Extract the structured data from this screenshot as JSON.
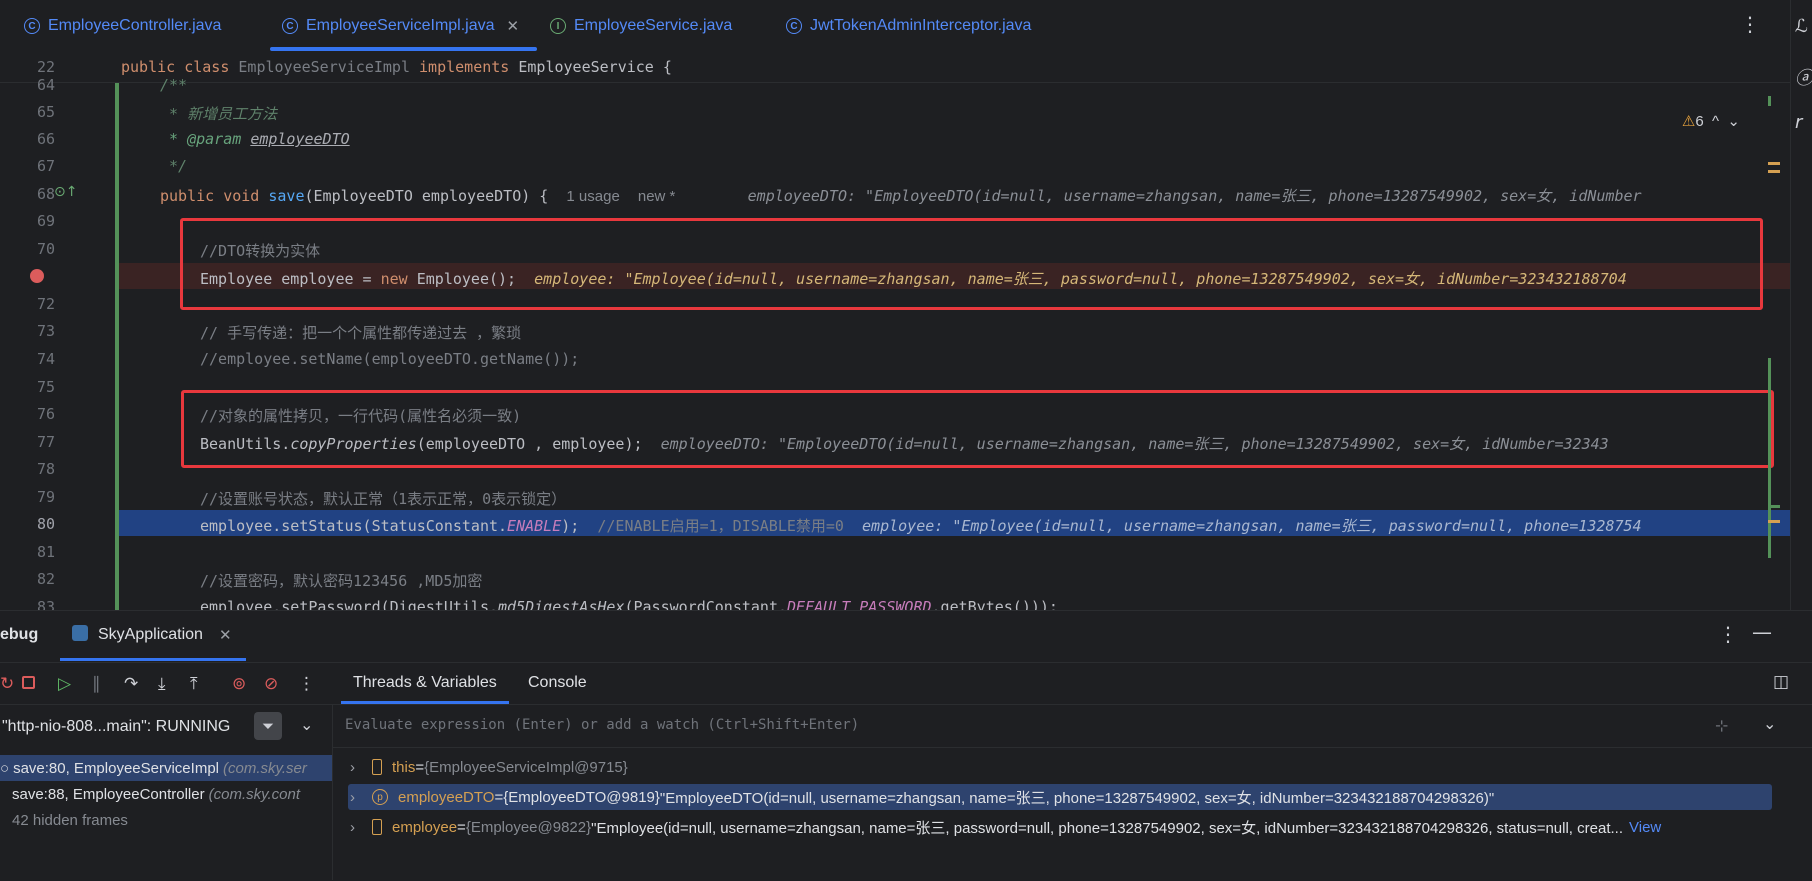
{
  "tabs": [
    {
      "label": "EmployeeController.java",
      "icon": "class-icon"
    },
    {
      "label": "EmployeeServiceImpl.java",
      "icon": "class-icon",
      "active": true
    },
    {
      "label": "EmployeeService.java",
      "icon": "interface-icon"
    },
    {
      "label": "JwtTokenAdminInterceptor.java",
      "icon": "class-icon"
    }
  ],
  "right_strip": [
    "ℒ",
    "ⓐ",
    "r"
  ],
  "editor": {
    "sticky": {
      "line": "22",
      "kw1": "public class ",
      "cls": "EmployeeServiceImpl ",
      "kw2": "implements ",
      "iface": "EmployeeService {"
    },
    "inspections": "6",
    "lines": {
      "64": {
        "num": "64",
        "text": "/**"
      },
      "65": {
        "num": "65",
        "text": " * 新增员工方法"
      },
      "66": {
        "num": "66",
        "tag": " * @param ",
        "param": "employeeDTO"
      },
      "67": {
        "num": "67",
        "text": " */"
      },
      "68": {
        "num": "68",
        "kw": "public void ",
        "fn": "save",
        "rest": "(EmployeeDTO employeeDTO) {",
        "usage": "1 usage",
        "new": "new *",
        "hint": "employeeDTO: \"EmployeeDTO(id=null, username=zhangsan, name=张三, phone=13287549902, sex=女, idNumber"
      },
      "69": {
        "num": "69"
      },
      "70": {
        "num": "70",
        "text": "//DTO转换为实体"
      },
      "71": {
        "pre": "Employee employee = ",
        "kw": "new ",
        "post": "Employee();",
        "hint": "employee: \"Employee(id=null, username=zhangsan, name=张三, password=null, phone=13287549902, sex=女, idNumber=323432188704"
      },
      "72": {
        "num": "72"
      },
      "73": {
        "num": "73",
        "text": "// 手写传递：把一个个属性都传递过去 ，繁琐"
      },
      "74": {
        "num": "74",
        "text": "//employee.setName(employeeDTO.getName());"
      },
      "75": {
        "num": "75"
      },
      "76": {
        "num": "76",
        "text": "//对象的属性拷贝，一行代码(属性名必须一致)"
      },
      "77": {
        "num": "77",
        "pre": "BeanUtils.",
        "fn": "copyProperties",
        "post": "(employeeDTO , employee);",
        "hint": "employeeDTO: \"EmployeeDTO(id=null, username=zhangsan, name=张三, phone=13287549902, sex=女, idNumber=32343"
      },
      "78": {
        "num": "78"
      },
      "79": {
        "num": "79",
        "text": "//设置账号状态，默认正常（1表示正常，0表示锁定）"
      },
      "80": {
        "num": "80",
        "pre": "employee.setStatus(StatusConstant.",
        "const": "ENABLE",
        "post": ");",
        "comment": "//ENABLE启用=1，DISABLE禁用=0",
        "hint": "employee: \"Employee(id=null, username=zhangsan, name=张三, password=null, phone=1328754"
      },
      "81": {
        "num": "81"
      },
      "82": {
        "num": "82",
        "text": "//设置密码，默认密码123456 ,MD5加密"
      },
      "83": {
        "num": "83",
        "pre": "employee.setPassword(DigestUtils.",
        "fn": "md5DigestAsHex",
        "mid": "(PasswordConstant.",
        "const": "DEFAULT_PASSWORD",
        "post": ".getBytes()));"
      }
    }
  },
  "debug": {
    "title": "ebug",
    "run_config": "SkyApplication",
    "tabs": {
      "threads": "Threads & Variables",
      "console": "Console"
    },
    "thread": "\"http-nio-808...main\": RUNNING",
    "eval_placeholder": "Evaluate expression (Enter) or add a watch (Ctrl+Shift+Enter)",
    "frames": [
      {
        "method": "save:80, EmployeeServiceImpl",
        "pkg": "(com.sky.ser"
      },
      {
        "method": "save:88, EmployeeController",
        "pkg": "(com.sky.cont"
      }
    ],
    "hidden_frames": "42 hidden frames",
    "variables": [
      {
        "name": "this",
        "eq": " = ",
        "type": "{EmployeeServiceImpl@9715}",
        "value": ""
      },
      {
        "name": "employeeDTO",
        "eq": " = ",
        "type": "{EmployeeDTO@9819}",
        "value": " \"EmployeeDTO(id=null, username=zhangsan, name=张三, phone=13287549902, sex=女, idNumber=323432188704298326)\""
      },
      {
        "name": "employee",
        "eq": " = ",
        "type": "{Employee@9822}",
        "value": " \"Employee(id=null, username=zhangsan, name=张三, password=null, phone=13287549902, sex=女, idNumber=323432188704298326, status=null, creat...",
        "link": "View"
      }
    ]
  },
  "colors": {
    "accent": "#3574f0",
    "highlight": "#214283",
    "redbox": "#e8383d",
    "breakpoint": "#db5c5c"
  }
}
